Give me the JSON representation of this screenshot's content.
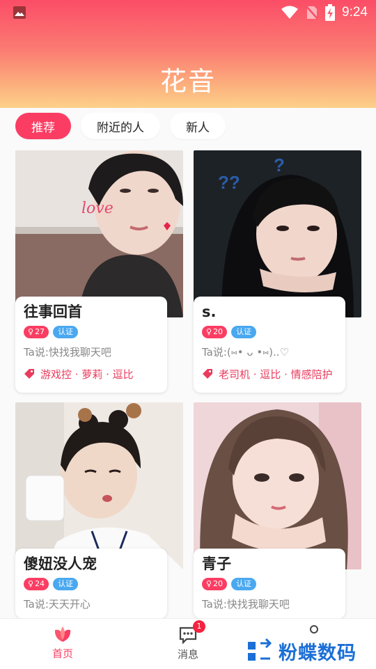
{
  "status_bar": {
    "time": "9:24"
  },
  "header": {
    "title": "花音"
  },
  "tabs": [
    {
      "label": "推荐",
      "active": true
    },
    {
      "label": "附近的人",
      "active": false
    },
    {
      "label": "新人",
      "active": false
    }
  ],
  "cards": [
    {
      "name": "往事回首",
      "age": "27",
      "verify": "认证",
      "quote": "Ta说:快找我聊天吧",
      "tags": "游戏控 · 萝莉 · 逗比",
      "photo_text": "love"
    },
    {
      "name": "s.",
      "age": "20",
      "verify": "认证",
      "quote": "Ta说:(⑅• ᴗ •⑅)..♡",
      "tags": "老司机 · 逗比 · 情感陪护",
      "photo_text": "??"
    },
    {
      "name": "傻妞没人宠",
      "age": "24",
      "verify": "认证",
      "quote": "Ta说:天天开心"
    },
    {
      "name": "青子",
      "age": "20",
      "verify": "认证",
      "quote": "Ta说:快找我聊天吧"
    }
  ],
  "bottom_nav": [
    {
      "label": "首页",
      "icon": "petal-icon",
      "active": true
    },
    {
      "label": "消息",
      "icon": "chat-icon",
      "badge": "1"
    }
  ],
  "watermark": {
    "text": "粉蝶数码"
  },
  "colors": {
    "accent": "#fb3d63",
    "verify": "#4aa8f0",
    "tag_text": "#e93b5d"
  }
}
